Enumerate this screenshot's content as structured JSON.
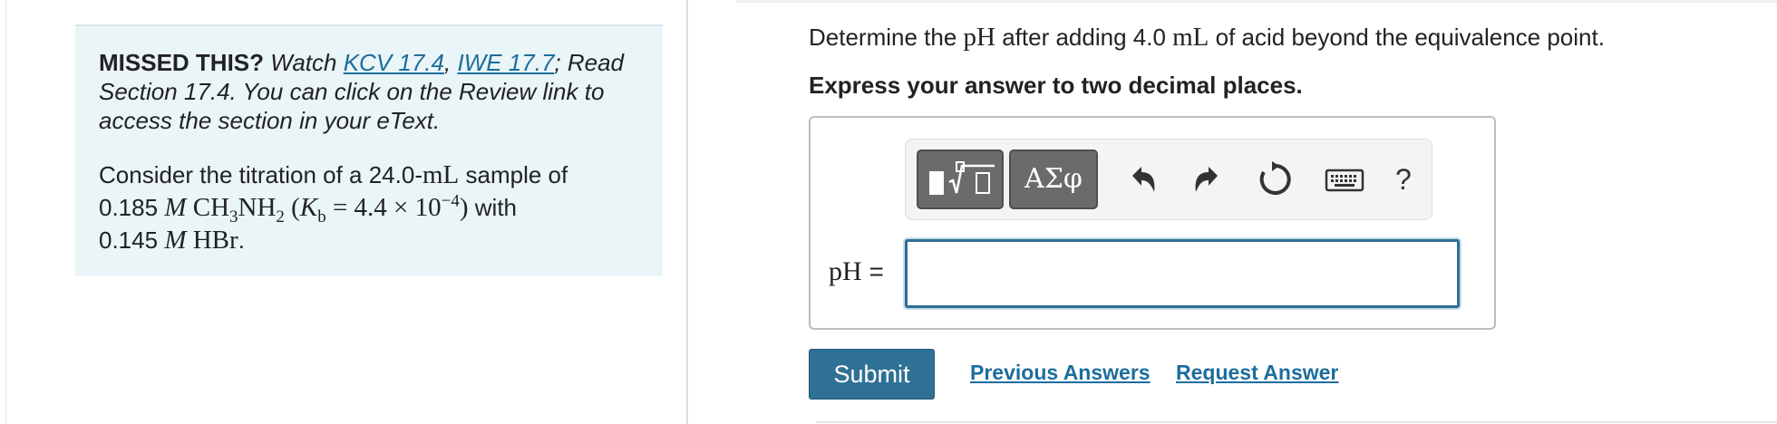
{
  "left_panel": {
    "missed": {
      "lead": "MISSED THIS?",
      "watch": "Watch",
      "link1": "KCV 17.4",
      "comma": ",",
      "link2": "IWE 17.7",
      "rest": "; Read Section 17.4. You can click on the Review link to access the section in your eText."
    },
    "problem": {
      "intro": "Consider the titration of a 24.0-",
      "unit_mL": "mL",
      "sample_of": " sample of",
      "base_conc": "0.185",
      "molar": "M",
      "base_formula_a": "CH",
      "base_sub3": "3",
      "base_formula_b": "NH",
      "base_sub2": "2",
      "kb_open": "(",
      "kb_K": "K",
      "kb_sub": "b",
      "kb_eq": " = 4.4 × 10",
      "kb_exp": "−4",
      "kb_close": ")",
      "with": " with",
      "acid_conc": "0.145",
      "acid_molar": "M",
      "acid_formula": "HBr",
      "period": "."
    }
  },
  "question": {
    "prefix": "Determine the ",
    "ph": "pH",
    "middle": " after adding 4.0 ",
    "unit": "mL",
    "suffix": " of acid beyond the equivalence point."
  },
  "instruction": "Express your answer to two decimal places.",
  "toolbar": {
    "symbols_label": "ΑΣφ",
    "icons": [
      "templates-icon",
      "undo-icon",
      "redo-icon",
      "reset-icon",
      "keyboard-icon",
      "help-icon"
    ],
    "help_label": "?"
  },
  "answer": {
    "label": "pH",
    "equals": " =",
    "value": "",
    "placeholder": ""
  },
  "actions": {
    "submit": "Submit",
    "previous_answers": "Previous Answers",
    "request_answer": "Request Answer"
  },
  "colors": {
    "panel_bg": "#eaf5f7",
    "link": "#1d6d9d",
    "submit_bg": "#2f7195",
    "input_border": "#2e6f94",
    "tool_button": "#6b6b6b"
  }
}
